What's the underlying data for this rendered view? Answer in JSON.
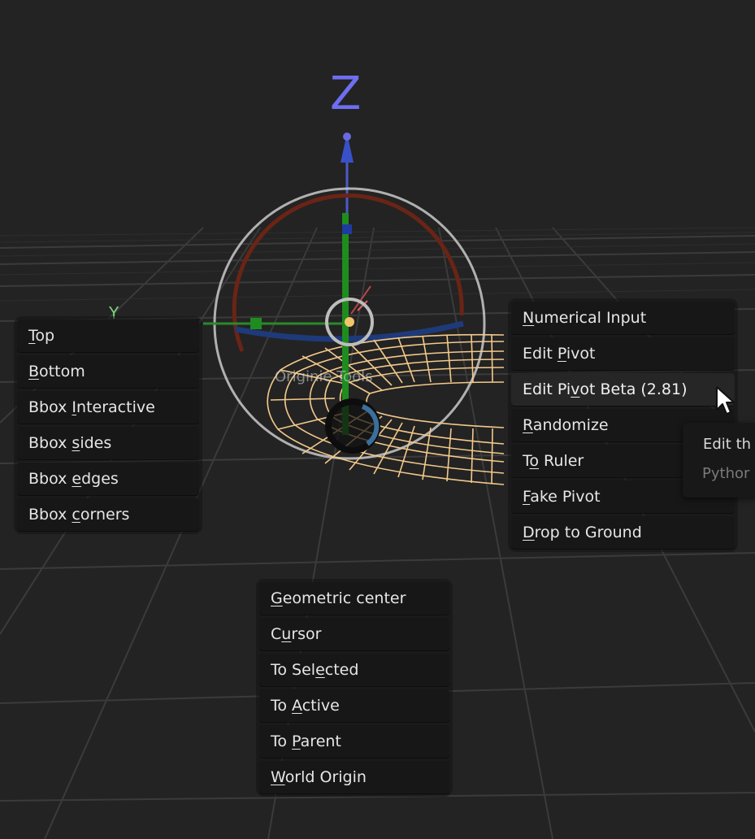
{
  "viewport": {
    "axis_label": "Z",
    "pie_title": "Originie Tools"
  },
  "left_menu": {
    "items": [
      {
        "mnemonic": "T",
        "rest": "op"
      },
      {
        "mnemonic": "B",
        "rest": "ottom"
      },
      {
        "pre": "Bbox ",
        "mnemonic": "I",
        "rest": "nteractive"
      },
      {
        "pre": "Bbox ",
        "mnemonic": "s",
        "rest": "ides"
      },
      {
        "pre": "Bbox ",
        "mnemonic": "e",
        "rest": "dges"
      },
      {
        "pre": "Bbox ",
        "mnemonic": "c",
        "rest": "orners"
      }
    ]
  },
  "right_menu": {
    "items": [
      {
        "mnemonic": "N",
        "rest": "umerical Input"
      },
      {
        "pre": "Edit ",
        "mnemonic": "P",
        "rest": "ivot"
      },
      {
        "pre": "Edit Pi",
        "mnemonic": "v",
        "rest": "ot Beta (2.81)"
      },
      {
        "mnemonic": "R",
        "rest": "andomize"
      },
      {
        "pre": "T",
        "mnemonic": "o",
        "rest": " Ruler"
      },
      {
        "mnemonic": "F",
        "rest": "ake Pivot"
      },
      {
        "mnemonic": "D",
        "rest": "rop to Ground"
      }
    ]
  },
  "bottom_menu": {
    "items": [
      {
        "mnemonic": "G",
        "rest": "eometric center"
      },
      {
        "pre": "C",
        "mnemonic": "u",
        "rest": "rsor"
      },
      {
        "pre": "To Sel",
        "mnemonic": "e",
        "rest": "cted"
      },
      {
        "pre": "To ",
        "mnemonic": "A",
        "rest": "ctive"
      },
      {
        "pre": "To ",
        "mnemonic": "P",
        "rest": "arent"
      },
      {
        "mnemonic": "W",
        "rest": "orld Origin"
      }
    ]
  },
  "tooltip": {
    "title": "Edit th",
    "python": "Pythor"
  },
  "colors": {
    "background": "#232323",
    "grid": "#3a3a3a",
    "axis_x": "#a23a3a",
    "axis_y": "#1f8c1f",
    "axis_z": "#4a5ac8",
    "wireframe": "#f3c98a",
    "gizmo_ring": "#c9c9c9"
  }
}
